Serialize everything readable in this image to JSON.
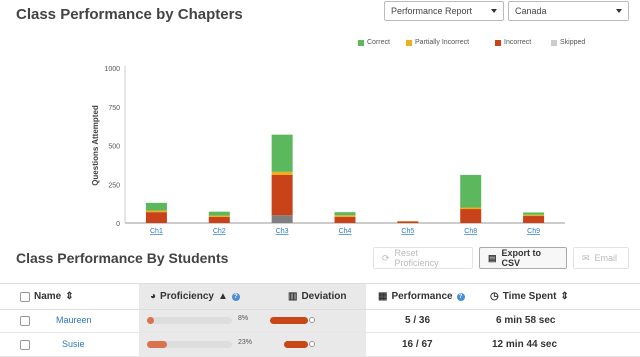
{
  "header": {
    "title": "Class Performance by Chapters"
  },
  "filters": {
    "report": "Performance Report",
    "country": "Canada"
  },
  "legend": [
    {
      "label": "Correct",
      "color": "#5cb85c"
    },
    {
      "label": "Partially Incorrect",
      "color": "#f0ad1e"
    },
    {
      "label": "Incorrect",
      "color": "#c8431a"
    },
    {
      "label": "Skipped",
      "color": "#cccccc"
    }
  ],
  "chart_data": {
    "type": "bar",
    "stacked": true,
    "ylabel": "Questions Attempted",
    "ylim": [
      0,
      1000
    ],
    "yticks": [
      "0",
      "250",
      "500",
      "750",
      "1000"
    ],
    "categories": [
      "Ch1",
      "Ch2",
      "Ch3",
      "Ch4",
      "Ch5",
      "Ch8",
      "Ch9"
    ],
    "series": [
      {
        "name": "Skipped",
        "color": "#7f7f7f",
        "values": [
          0,
          0,
          50,
          0,
          0,
          0,
          0
        ]
      },
      {
        "name": "Incorrect",
        "color": "#c8431a",
        "values": [
          70,
          40,
          260,
          40,
          10,
          90,
          45
        ]
      },
      {
        "name": "Partially Incorrect",
        "color": "#f0ad1e",
        "values": [
          10,
          8,
          20,
          10,
          2,
          10,
          8
        ]
      },
      {
        "name": "Correct",
        "color": "#5cb85c",
        "values": [
          50,
          25,
          240,
          20,
          0,
          210,
          15
        ]
      }
    ]
  },
  "students_section": {
    "title": "Class Performance By Students",
    "reset_label": "Reset Proficiency",
    "export_label": "Export to CSV",
    "email_label": "Email"
  },
  "table": {
    "headers": {
      "name": "Name",
      "proficiency": "Proficiency",
      "deviation": "Deviation",
      "performance": "Performance",
      "time": "Time Spent"
    },
    "rows": [
      {
        "name": "Maureen",
        "proficiency_pct": "8%",
        "proficiency": 0.08,
        "performance": "5 / 36",
        "time": "6 min 58 sec"
      },
      {
        "name": "Susie",
        "proficiency_pct": "23%",
        "proficiency": 0.23,
        "performance": "16 / 67",
        "time": "12 min 44 sec"
      }
    ]
  }
}
